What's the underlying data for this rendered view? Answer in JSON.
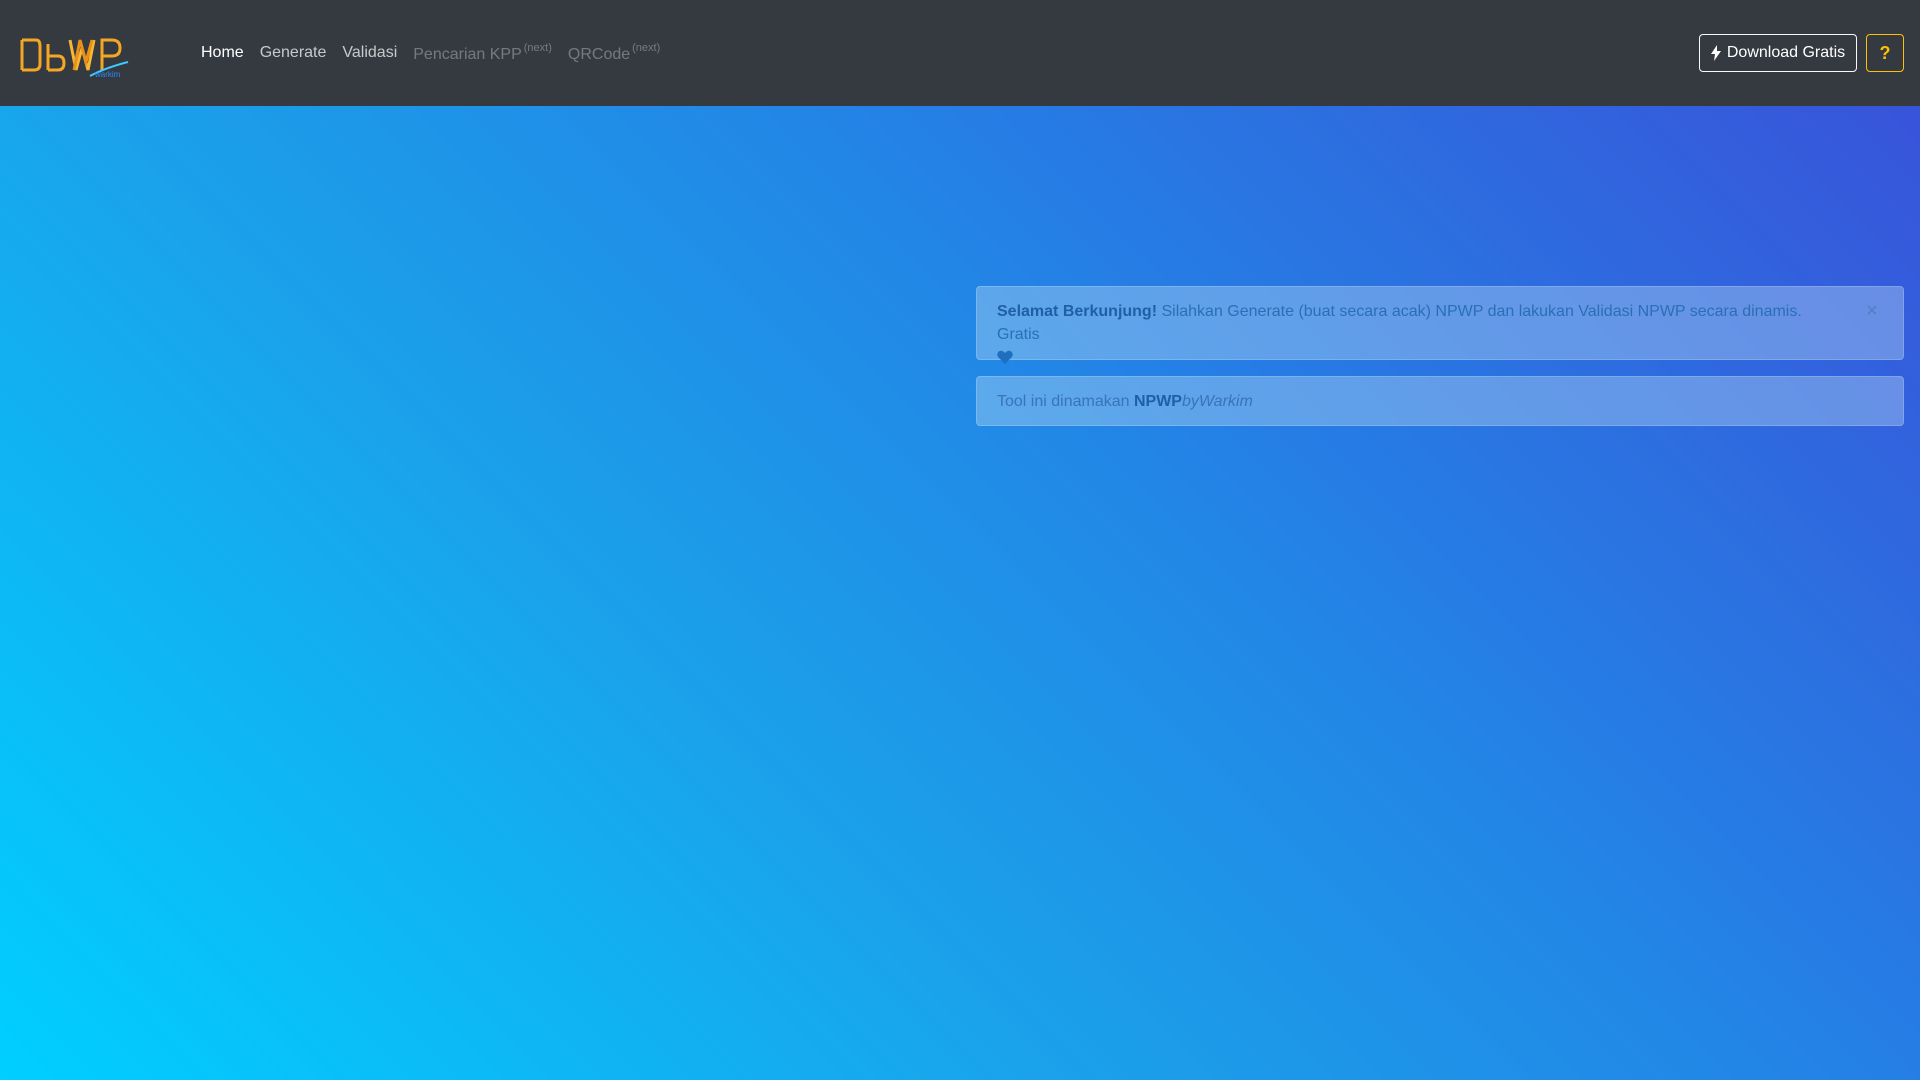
{
  "app": {
    "brand_logo_text": "NPWP",
    "brand_logo_sub": "warkim"
  },
  "nav": {
    "items": [
      {
        "label": "Home",
        "state": "active"
      },
      {
        "label": "Generate",
        "state": "normal"
      },
      {
        "label": "Validasi",
        "state": "normal"
      },
      {
        "label": "Pencarian KPP",
        "sup": "(next)",
        "state": "disabled"
      },
      {
        "label": "QRCode",
        "sup": "(next)",
        "state": "disabled"
      }
    ]
  },
  "actions": {
    "download_label": "Download Gratis",
    "download_icon": "bolt-icon",
    "help_label": "?"
  },
  "alerts": {
    "welcome": {
      "strong": "Selamat Berkunjung!",
      "text": " Silahkan Generate (buat secara acak) NPWP dan lakukan Validasi NPWP secara dinamis. Gratis",
      "icon": "heart-icon",
      "close_label": "×"
    },
    "info": {
      "prefix": "Tool ini dinamakan ",
      "strong": "NPWP",
      "em": "byWarkim"
    }
  },
  "colors": {
    "navbar_bg": "#343a40",
    "gradient_start": "#00cfff",
    "gradient_end": "#3a4fd8",
    "help_accent": "#ffc107",
    "alert_text": "#2a6fb5"
  }
}
